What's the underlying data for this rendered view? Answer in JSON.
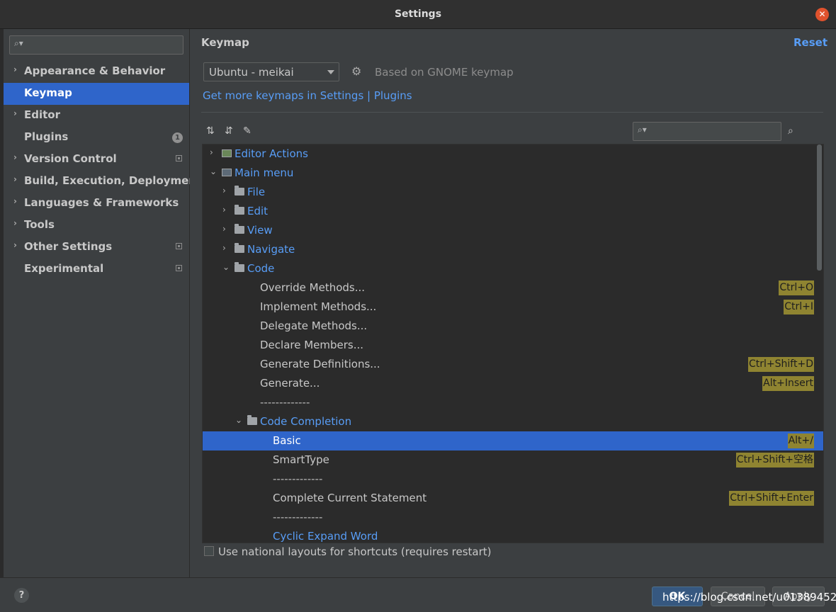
{
  "window": {
    "title": "Settings",
    "close_icon": "close-icon"
  },
  "sidebar": {
    "search_placeholder": "",
    "items": [
      {
        "label": "Appearance & Behavior",
        "expandable": true,
        "selected": false
      },
      {
        "label": "Keymap",
        "expandable": false,
        "selected": true
      },
      {
        "label": "Editor",
        "expandable": true,
        "selected": false
      },
      {
        "label": "Plugins",
        "expandable": false,
        "selected": false,
        "badge": "1"
      },
      {
        "label": "Version Control",
        "expandable": true,
        "selected": false,
        "project_icon": true
      },
      {
        "label": "Build, Execution, Deployment",
        "expandable": true,
        "selected": false
      },
      {
        "label": "Languages & Frameworks",
        "expandable": true,
        "selected": false
      },
      {
        "label": "Tools",
        "expandable": true,
        "selected": false
      },
      {
        "label": "Other Settings",
        "expandable": true,
        "selected": false,
        "project_icon": true
      },
      {
        "label": "Experimental",
        "expandable": false,
        "selected": false,
        "project_icon": true
      }
    ]
  },
  "main": {
    "heading": "Keymap",
    "reset_label": "Reset",
    "keymap_select": {
      "value": "Ubuntu - meikai"
    },
    "based_on": "Based on GNOME keymap",
    "get_more_link": "Get more keymaps in Settings | Plugins",
    "filter_placeholder": "",
    "tree": [
      {
        "label": "Editor Actions",
        "level": 0,
        "expanded": false,
        "icon": "editor-actions-icon",
        "style": "link"
      },
      {
        "label": "Main menu",
        "level": 0,
        "expanded": true,
        "icon": "menu-icon",
        "style": "link"
      },
      {
        "label": "File",
        "level": 1,
        "expanded": false,
        "icon": "folder-icon",
        "style": "link"
      },
      {
        "label": "Edit",
        "level": 1,
        "expanded": false,
        "icon": "folder-icon",
        "style": "link"
      },
      {
        "label": "View",
        "level": 1,
        "expanded": false,
        "icon": "folder-icon",
        "style": "link"
      },
      {
        "label": "Navigate",
        "level": 1,
        "expanded": false,
        "icon": "folder-icon",
        "style": "link"
      },
      {
        "label": "Code",
        "level": 1,
        "expanded": true,
        "icon": "folder-icon",
        "style": "link"
      },
      {
        "label": "Override Methods...",
        "level": 2,
        "shortcut": "Ctrl+O",
        "style": "plain"
      },
      {
        "label": "Implement Methods...",
        "level": 2,
        "shortcut": "Ctrl+I",
        "style": "plain"
      },
      {
        "label": "Delegate Methods...",
        "level": 2,
        "style": "plain"
      },
      {
        "label": "Declare Members...",
        "level": 2,
        "style": "plain"
      },
      {
        "label": "Generate Definitions...",
        "level": 2,
        "shortcut": "Ctrl+Shift+D",
        "style": "plain"
      },
      {
        "label": "Generate...",
        "level": 2,
        "shortcut": "Alt+Insert",
        "style": "plain"
      },
      {
        "label": "-------------",
        "level": 2,
        "style": "dim"
      },
      {
        "label": "Code Completion",
        "level": 2,
        "expanded": true,
        "icon": "folder-icon",
        "style": "link"
      },
      {
        "label": "Basic",
        "level": 3,
        "shortcut": "Alt+/",
        "style": "plain",
        "selected": true
      },
      {
        "label": "SmartType",
        "level": 3,
        "shortcut": "Ctrl+Shift+空格",
        "style": "plain"
      },
      {
        "label": "-------------",
        "level": 3,
        "style": "dim"
      },
      {
        "label": "Complete Current Statement",
        "level": 3,
        "shortcut": "Ctrl+Shift+Enter",
        "style": "plain"
      },
      {
        "label": "-------------",
        "level": 3,
        "style": "dim"
      },
      {
        "label": "Cyclic Expand Word",
        "level": 3,
        "style": "link"
      }
    ],
    "national_layouts_label": "Use national layouts for shortcuts (requires restart)",
    "national_layouts_checked": false
  },
  "footer": {
    "help_label": "?",
    "ok_label": "OK",
    "cancel_label": "Cancel",
    "apply_label": "Apply"
  },
  "watermark": "https://blog.csdn.net/u013894527"
}
